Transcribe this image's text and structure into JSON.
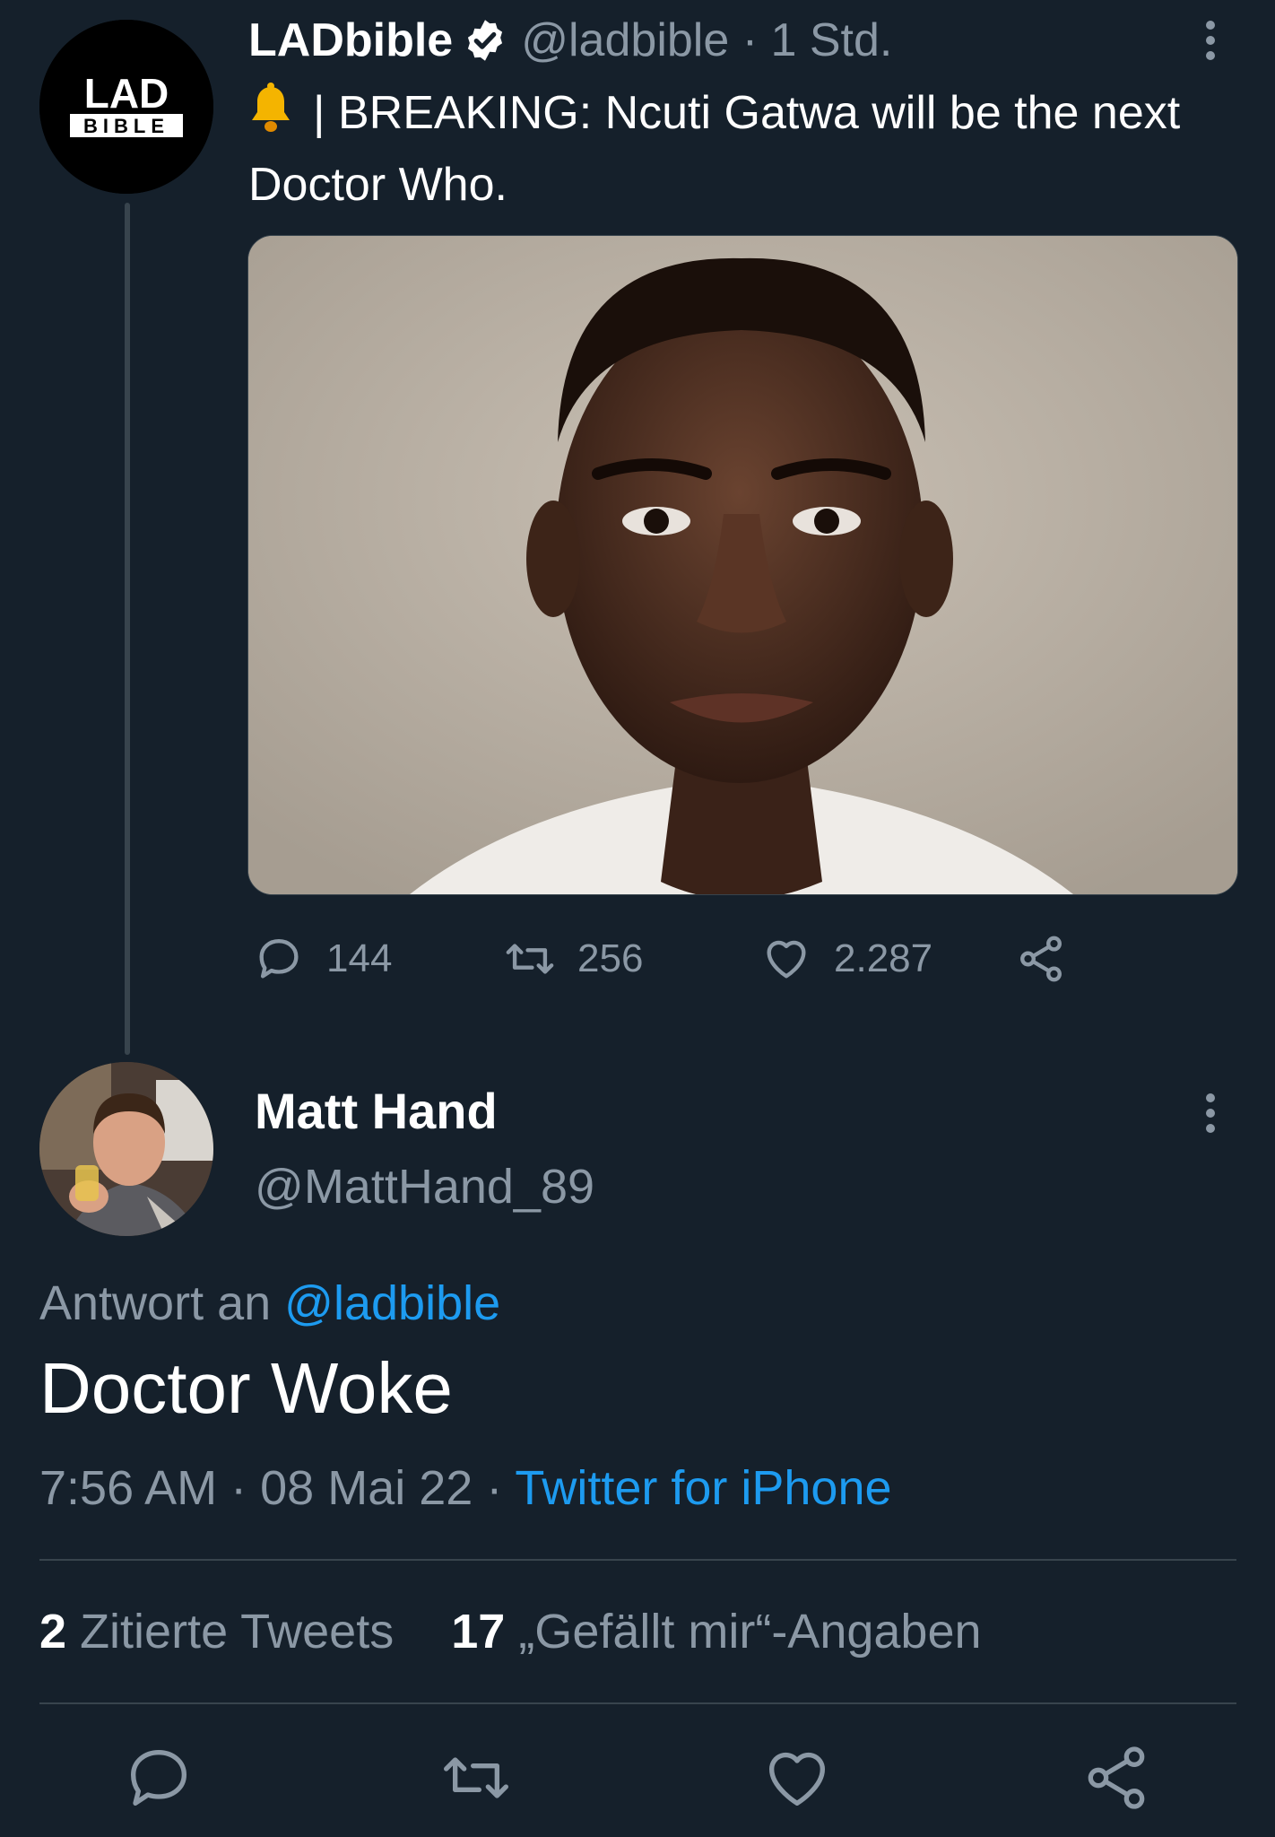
{
  "original_tweet": {
    "avatar_text_top": "LAD",
    "avatar_text_bottom": "BIBLE",
    "name": "LADbible",
    "handle": "@ladbible",
    "time": "1 Std.",
    "meta_separator": "·",
    "text": "| BREAKING: Ncuti Gatwa will be the next Doctor Who.",
    "image_alt": "Ncuti Gatwa portrait",
    "actions": {
      "replies": "144",
      "retweets": "256",
      "likes": "2.287"
    }
  },
  "reply": {
    "name": "Matt Hand",
    "handle": "@MattHand_89",
    "reply_to_prefix": "Antwort an",
    "reply_to_handle": "@ladbible",
    "text": "Doctor Woke",
    "time": "7:56 AM",
    "date": "08 Mai 22",
    "separator": "·",
    "source": "Twitter for iPhone",
    "quote_count": "2",
    "quote_label": "Zitierte Tweets",
    "like_count": "17",
    "like_label": "„Gefällt mir“-Angaben"
  },
  "colors": {
    "background": "#15202b",
    "muted": "#8b98a5",
    "link": "#1d9bf0",
    "divider": "#38444d"
  },
  "icons": [
    "verified-icon",
    "bell-icon",
    "more-icon",
    "reply-icon",
    "retweet-icon",
    "like-icon",
    "share-icon"
  ]
}
